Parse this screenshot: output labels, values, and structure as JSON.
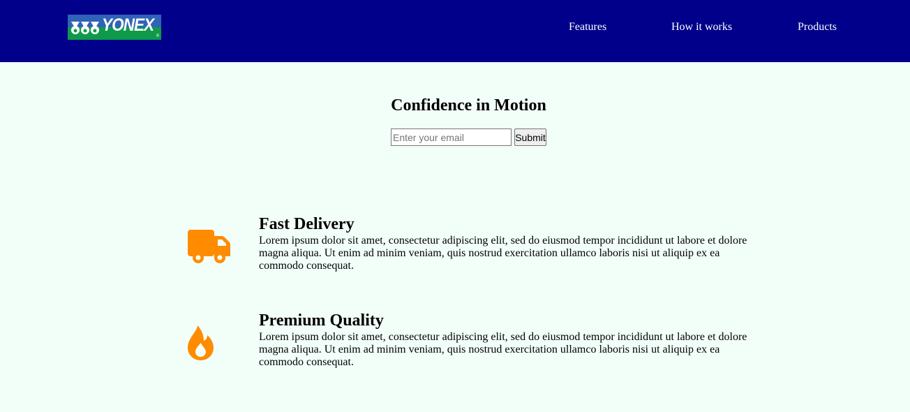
{
  "header": {
    "logo": {
      "text": "YONEX",
      "reg": "®",
      "colors": {
        "top": "#2f63b7",
        "bottom": "#0e9a4a"
      }
    },
    "nav": [
      {
        "label": "Features"
      },
      {
        "label": "How it works"
      },
      {
        "label": "Products"
      }
    ],
    "background": "#00008b"
  },
  "hero": {
    "title": "Confidence in Motion",
    "email_placeholder": "Enter your email",
    "submit_label": "Submit"
  },
  "features": [
    {
      "icon": "truck-icon",
      "title": "Fast Delivery",
      "text": "Lorem ipsum dolor sit amet, consectetur adipiscing elit, sed do eiusmod tempor incididunt ut labore et dolore magna aliqua. Ut enim ad minim veniam, quis nostrud exercitation ullamco laboris nisi ut aliquip ex ea commodo consequat."
    },
    {
      "icon": "fire-icon",
      "title": "Premium Quality",
      "text": "Lorem ipsum dolor sit amet, consectetur adipiscing elit, sed do eiusmod tempor incididunt ut labore et dolore magna aliqua. Ut enim ad minim veniam, quis nostrud exercitation ullamco laboris nisi ut aliquip ex ea commodo consequat."
    }
  ],
  "colors": {
    "page_background": "#f2fff9",
    "icon_accent": "#ff8c00"
  }
}
